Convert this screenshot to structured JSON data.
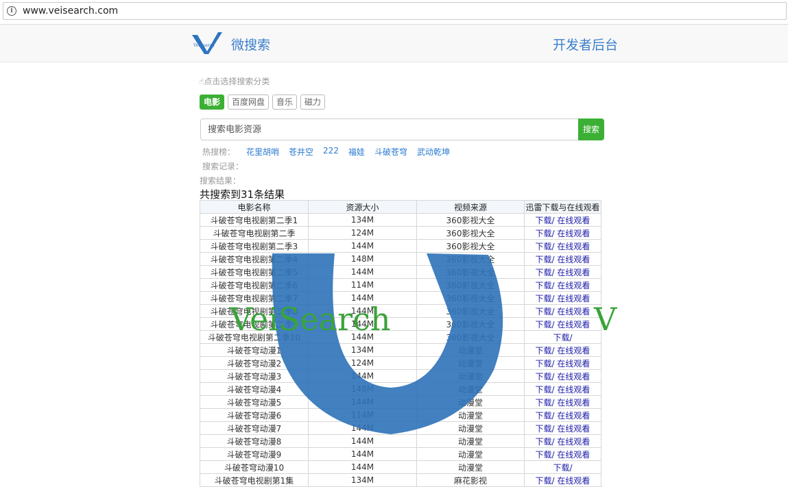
{
  "browser": {
    "url": "www.veisearch.com"
  },
  "header": {
    "brand": "微搜索",
    "dev_link": "开发者后台",
    "logo_text": "VeiSearch"
  },
  "category_hint": "点击选择搜索分类",
  "categories": [
    "电影",
    "百度网盘",
    "音乐",
    "磁力"
  ],
  "search": {
    "placeholder": "搜索电影资源",
    "button": "搜索"
  },
  "hot": {
    "label": "热搜榜：",
    "keywords": [
      "花里胡哨",
      "苍井空",
      "222",
      "福娃",
      "斗破苍穹",
      "武动乾坤"
    ]
  },
  "history_label": "搜索记录：",
  "results_label": "搜索结果：",
  "results_count": "共搜索到31条结果",
  "watermark_text": "VeiSearch",
  "table": {
    "headers": [
      "电影名称",
      "资源大小",
      "视频来源",
      "迅雷下载与在线观看"
    ],
    "download_label": "下载/",
    "watch_label": "在线观看",
    "rows": [
      {
        "name": "斗破苍穹电视剧第二季1",
        "size": "134M",
        "source": "360影视大全",
        "watch": true
      },
      {
        "name": "斗破苍穹电视剧第二季",
        "size": "124M",
        "source": "360影视大全",
        "watch": true
      },
      {
        "name": "斗破苍穹电视剧第二季3",
        "size": "144M",
        "source": "360影视大全",
        "watch": true
      },
      {
        "name": "斗破苍穹电视剧第二季4",
        "size": "148M",
        "source": "360影视大全",
        "watch": true
      },
      {
        "name": "斗破苍穹电视剧第二季5",
        "size": "144M",
        "source": "360影视大全",
        "watch": true
      },
      {
        "name": "斗破苍穹电视剧第二季6",
        "size": "114M",
        "source": "360影视大全",
        "watch": true
      },
      {
        "name": "斗破苍穹电视剧第二季7",
        "size": "144M",
        "source": "360影视大全",
        "watch": true
      },
      {
        "name": "斗破苍穹电视剧第二季8",
        "size": "144M",
        "source": "360影视大全",
        "watch": true
      },
      {
        "name": "斗破苍穹电视剧第二季9",
        "size": "144M",
        "source": "360影视大全",
        "watch": true
      },
      {
        "name": "斗破苍穹电视剧第二季10",
        "size": "144M",
        "source": "360影视大全",
        "watch": false
      },
      {
        "name": "斗破苍穹动漫1",
        "size": "134M",
        "source": "动漫堂",
        "watch": true
      },
      {
        "name": "斗破苍穹动漫2",
        "size": "124M",
        "source": "动漫堂",
        "watch": true
      },
      {
        "name": "斗破苍穹动漫3",
        "size": "144M",
        "source": "动漫堂",
        "watch": true
      },
      {
        "name": "斗破苍穹动漫4",
        "size": "148M",
        "source": "动漫堂",
        "watch": true
      },
      {
        "name": "斗破苍穹动漫5",
        "size": "144M",
        "source": "动漫堂",
        "watch": true
      },
      {
        "name": "斗破苍穹动漫6",
        "size": "114M",
        "source": "动漫堂",
        "watch": true
      },
      {
        "name": "斗破苍穹动漫7",
        "size": "144M",
        "source": "动漫堂",
        "watch": true
      },
      {
        "name": "斗破苍穹动漫8",
        "size": "144M",
        "source": "动漫堂",
        "watch": true
      },
      {
        "name": "斗破苍穹动漫9",
        "size": "144M",
        "source": "动漫堂",
        "watch": true
      },
      {
        "name": "斗破苍穹动漫10",
        "size": "144M",
        "source": "动漫堂",
        "watch": false
      },
      {
        "name": "斗破苍穹电视剧第1集",
        "size": "134M",
        "source": "麻花影视",
        "watch": true
      }
    ]
  },
  "colors": {
    "brand_blue": "#3a7ecb",
    "accent_green": "#3cb035",
    "watermark_blue": "#2e72b8",
    "watermark_green": "#3aa33a"
  }
}
